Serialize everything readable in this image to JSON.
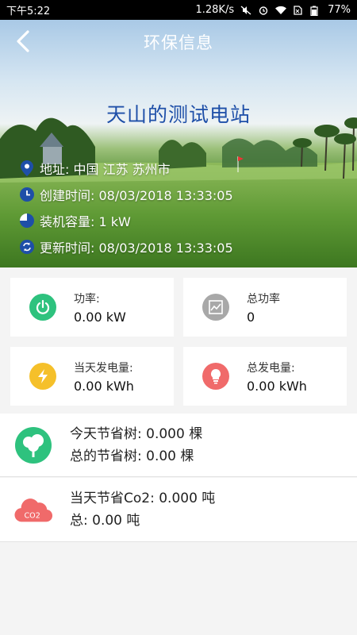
{
  "status_bar": {
    "time": "下午5:22",
    "speed": "1.28K/s",
    "battery": "77%"
  },
  "header": {
    "title": "环保信息"
  },
  "station": {
    "name": "天山的测试电站",
    "address": "地址: 中国 江苏 苏州市",
    "created": "创建时间: 08/03/2018 13:33:05",
    "capacity": "装机容量: 1 kW",
    "updated": "更新时间: 08/03/2018 13:33:05"
  },
  "cards": {
    "power_label": "功率:",
    "power_value": "0.00 kW",
    "total_power_label": "总功率",
    "total_power_value": "0",
    "today_gen_label": "当天发电量:",
    "today_gen_value": "0.00 kWh",
    "total_gen_label": "总发电量:",
    "total_gen_value": "0.00 kWh"
  },
  "trees": {
    "today": "今天节省树: 0.000 棵",
    "total": "总的节省树: 0.00 棵"
  },
  "co2": {
    "today": "当天节省Co2: 0.000 吨",
    "total": "总: 0.00 吨",
    "icon_text": "CO2"
  },
  "colors": {
    "power": "#2ec27e",
    "total_power": "#a8a8a8",
    "today_gen": "#f5c02a",
    "total_gen": "#f06a6a",
    "tree": "#2ec27e",
    "co2": "#f06a6a",
    "title_blue": "#1e4fa8"
  }
}
